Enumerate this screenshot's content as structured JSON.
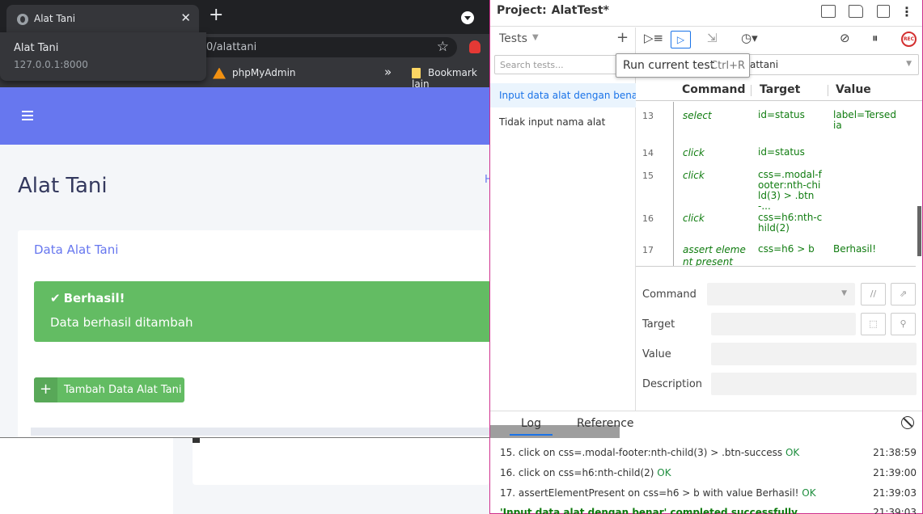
{
  "browser": {
    "tab_title": "Alat Tani",
    "tab_close": "✕",
    "new_tab": "+",
    "hover_title": "Alat Tani",
    "hover_url": "127.0.0.1:8000",
    "url_visible": "0/alattani",
    "star": "☆",
    "bookmarks": [
      {
        "label": "phpMyAdmin"
      },
      {
        "label": "Bookmark lain"
      }
    ],
    "more": "»"
  },
  "app": {
    "page_title": "Alat Tani",
    "breadcrumb_partial": "H",
    "card_title": "Data Alat Tani",
    "alert_heading": "Berhasil!",
    "alert_check": "✔",
    "alert_body": "Data berhasil ditambah",
    "add_button": "Tambah Data Alat Tani",
    "add_icon": "+",
    "accent": "#6777ef",
    "success": "#63bc63"
  },
  "ide": {
    "project_label": "Project:",
    "project_name": "AlatTest*",
    "tests_label": "Tests",
    "search_placeholder": "Search tests...",
    "tests": [
      {
        "name": "Input data alat dengan benar*",
        "selected": true
      },
      {
        "name": "Tidak input nama alat",
        "selected": false
      }
    ],
    "tooltip_text": "Run current test",
    "tooltip_shortcut": "Ctrl+R",
    "url_value": "attani",
    "record_label": "REC",
    "columns": {
      "command": "Command",
      "target": "Target",
      "value": "Value"
    },
    "commands": [
      {
        "num": "13",
        "cmd": "select",
        "target": "id=status",
        "value": "label=Tersedia"
      },
      {
        "num": "14",
        "cmd": "click",
        "target": "id=status",
        "value": ""
      },
      {
        "num": "15",
        "cmd": "click",
        "target": "css=.modal-footer:nth-child(3) > .btn-...",
        "value": ""
      },
      {
        "num": "16",
        "cmd": "click",
        "target": "css=h6:nth-child(2)",
        "value": ""
      },
      {
        "num": "17",
        "cmd": "assert element present",
        "target": "css=h6 > b",
        "value": "Berhasil!"
      }
    ],
    "editor": {
      "command_label": "Command",
      "target_label": "Target",
      "value_label": "Value",
      "description_label": "Description"
    },
    "log_tabs": {
      "log": "Log",
      "reference": "Reference"
    },
    "log": [
      {
        "text": "15. click on css=.modal-footer:nth-child(3) > .btn-success",
        "status": "OK",
        "time": "21:38:59"
      },
      {
        "text": "16. click on css=h6:nth-child(2)",
        "status": "OK",
        "time": "21:39:00"
      },
      {
        "text": "17. assertElementPresent on css=h6 > b with value Berhasil!",
        "status": "OK",
        "time": "21:39:03"
      },
      {
        "text": "'Input data alat dengan benar' completed successfully",
        "status": "",
        "time": "21:39:03"
      }
    ]
  }
}
